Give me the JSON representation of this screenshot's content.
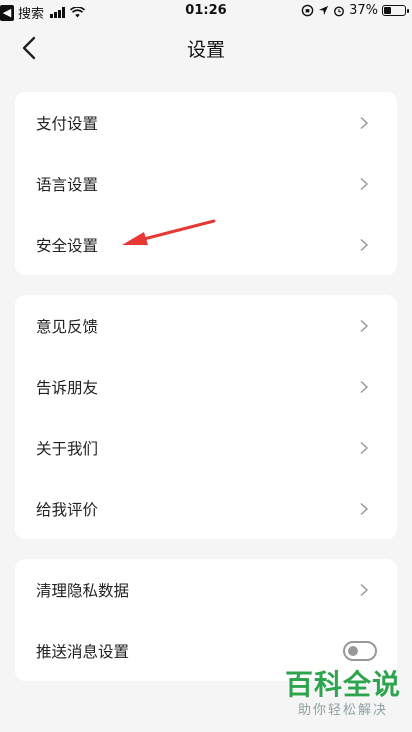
{
  "status_bar": {
    "app_back": "搜索",
    "time": "01:26",
    "battery_percent": "37%",
    "battery_level": 0.37
  },
  "nav": {
    "title": "设置"
  },
  "groups": [
    {
      "items": [
        {
          "label": "支付设置",
          "control": "chevron"
        },
        {
          "label": "语言设置",
          "control": "chevron"
        },
        {
          "label": "安全设置",
          "control": "chevron"
        }
      ]
    },
    {
      "items": [
        {
          "label": "意见反馈",
          "control": "chevron"
        },
        {
          "label": "告诉朋友",
          "control": "chevron"
        },
        {
          "label": "关于我们",
          "control": "chevron"
        },
        {
          "label": "给我评价",
          "control": "chevron"
        }
      ]
    },
    {
      "items": [
        {
          "label": "清理隐私数据",
          "control": "chevron"
        },
        {
          "label": "推送消息设置",
          "control": "toggle",
          "toggle_on": false
        }
      ]
    }
  ],
  "watermark": {
    "title": "百科全说",
    "subtitle": "助你轻松解决",
    "color": "#2fa44f"
  },
  "annotation_arrow_color": "#e53935"
}
